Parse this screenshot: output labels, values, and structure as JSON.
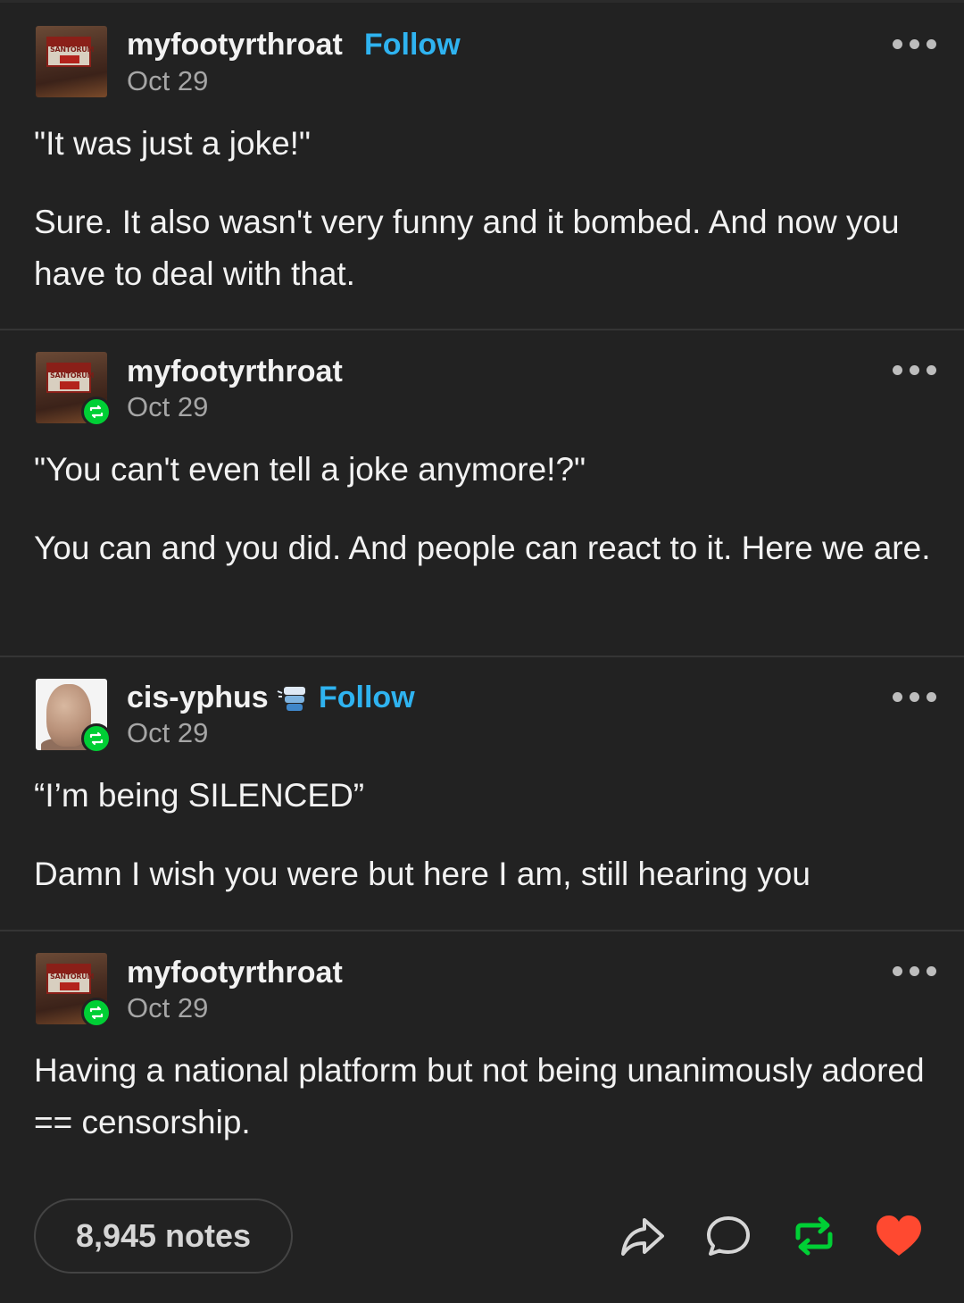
{
  "posts": [
    {
      "username": "myfootyrthroat",
      "follow_label": "Follow",
      "date": "Oct 29",
      "avatar_sign_text": "SANTORUM",
      "paragraphs": [
        "\"It was just a joke!\"",
        "Sure. It also wasn't very funny and it bombed. And now you have to deal with that."
      ]
    },
    {
      "username": "myfootyrthroat",
      "date": "Oct 29",
      "avatar_sign_text": "SANTORUM",
      "paragraphs": [
        "\"You can't even tell a joke anymore!?\"",
        "You can and you did. And people can react to it. Here we are."
      ]
    },
    {
      "username": "cis-yphus",
      "follow_label": "Follow",
      "date": "Oct 29",
      "paragraphs": [
        "“I’m being SILENCED”",
        "Damn I wish you were but here I am, still hearing you"
      ]
    },
    {
      "username": "myfootyrthroat",
      "date": "Oct 29",
      "avatar_sign_text": "SANTORUM",
      "paragraphs": [
        "Having a national platform but not being unanimously adored == censorship."
      ]
    }
  ],
  "footer": {
    "notes_label": "8,945 notes",
    "actions": [
      "share-icon",
      "reply-icon",
      "reblog-icon",
      "like-icon"
    ],
    "colors": {
      "reblog": "#00cf35",
      "like": "#ff4930",
      "follow": "#2fb3f0"
    }
  }
}
